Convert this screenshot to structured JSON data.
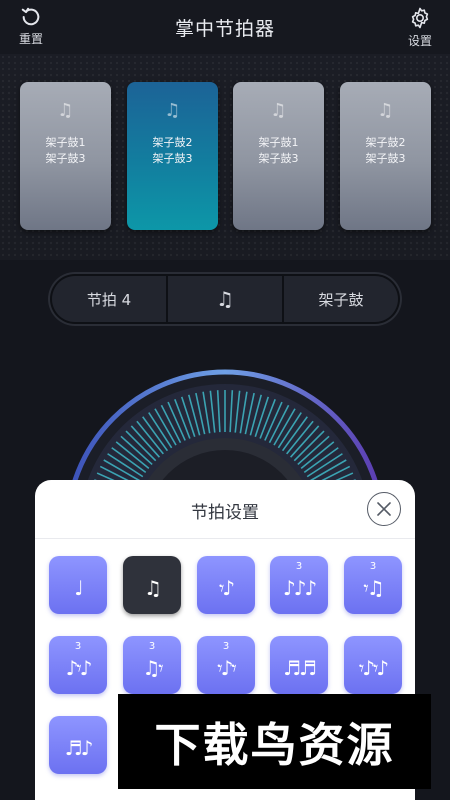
{
  "header": {
    "title": "掌中节拍器",
    "reset_label": "重置",
    "settings_label": "设置"
  },
  "pads": [
    {
      "line1": "架子鼓1",
      "line2": "架子鼓3",
      "active": false
    },
    {
      "line1": "架子鼓2",
      "line2": "架子鼓3",
      "active": true
    },
    {
      "line1": "架子鼓1",
      "line2": "架子鼓3",
      "active": false
    },
    {
      "line1": "架子鼓2",
      "line2": "架子鼓3",
      "active": false
    }
  ],
  "segment_bar": {
    "beat_label": "节拍 4",
    "note_glyph": "♫",
    "sound_label": "架子鼓"
  },
  "modal": {
    "title": "节拍设置",
    "rhythm_tiles": [
      {
        "glyph": "♩",
        "triplet": "",
        "selected": false
      },
      {
        "glyph": "♫",
        "triplet": "",
        "selected": true
      },
      {
        "glyph": "𝄾♪",
        "triplet": "",
        "selected": false
      },
      {
        "glyph": "♪♪♪",
        "triplet": "3",
        "selected": false
      },
      {
        "glyph": "𝄾♫",
        "triplet": "3",
        "selected": false
      },
      {
        "glyph": "♪𝄾♪",
        "triplet": "3",
        "selected": false
      },
      {
        "glyph": "♫𝄾",
        "triplet": "3",
        "selected": false
      },
      {
        "glyph": "𝄾♪𝄾",
        "triplet": "3",
        "selected": false
      },
      {
        "glyph": "♬♬",
        "triplet": "",
        "selected": false
      },
      {
        "glyph": "𝄾♪𝄾♪",
        "triplet": "",
        "selected": false
      },
      {
        "glyph": "♬♪",
        "triplet": "",
        "selected": false
      }
    ]
  },
  "watermark": "下载鸟资源",
  "colors": {
    "background": "#14161d",
    "active_pad": "#127e9f",
    "tile_accent": "#7a80f7"
  }
}
